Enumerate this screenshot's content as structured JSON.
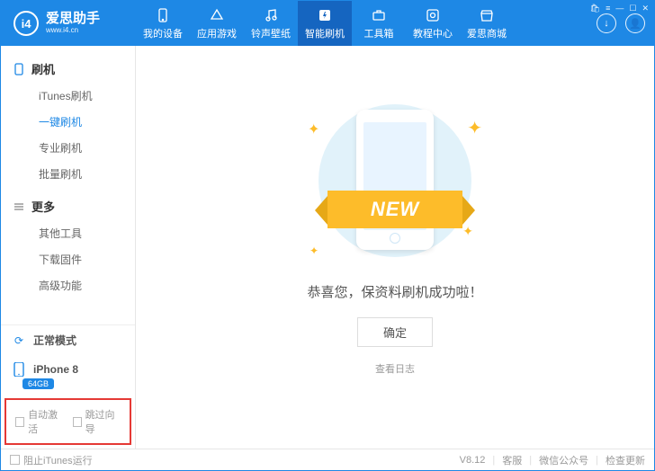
{
  "header": {
    "logo_initials": "i4",
    "logo_title": "爱思助手",
    "logo_sub": "www.i4.cn",
    "nav": [
      {
        "label": "我的设备",
        "icon": "phone"
      },
      {
        "label": "应用游戏",
        "icon": "app"
      },
      {
        "label": "铃声壁纸",
        "icon": "music"
      },
      {
        "label": "智能刷机",
        "icon": "flash",
        "active": true
      },
      {
        "label": "工具箱",
        "icon": "toolbox"
      },
      {
        "label": "教程中心",
        "icon": "book"
      },
      {
        "label": "爱思商城",
        "icon": "store"
      }
    ],
    "win_ctrl": {
      "cart": "🛍",
      "menu": "≡",
      "min": "—",
      "max": "☐",
      "close": "✕"
    }
  },
  "sidebar": {
    "sections": [
      {
        "title": "刷机",
        "items": [
          "iTunes刷机",
          "一键刷机",
          "专业刷机",
          "批量刷机"
        ],
        "active_index": 1
      },
      {
        "title": "更多",
        "items": [
          "其他工具",
          "下载固件",
          "高级功能"
        ],
        "active_index": -1
      }
    ],
    "mode_label": "正常模式",
    "device_name": "iPhone 8",
    "device_capacity": "64GB",
    "checkbox1": "自动激活",
    "checkbox2": "跳过向导"
  },
  "main": {
    "banner_text": "NEW",
    "success_message": "恭喜您，保资料刷机成功啦！",
    "confirm_button": "确定",
    "view_log": "查看日志"
  },
  "footer": {
    "block_itunes": "阻止iTunes运行",
    "version": "V8.12",
    "support": "客服",
    "wechat": "微信公众号",
    "check_update": "检查更新"
  }
}
